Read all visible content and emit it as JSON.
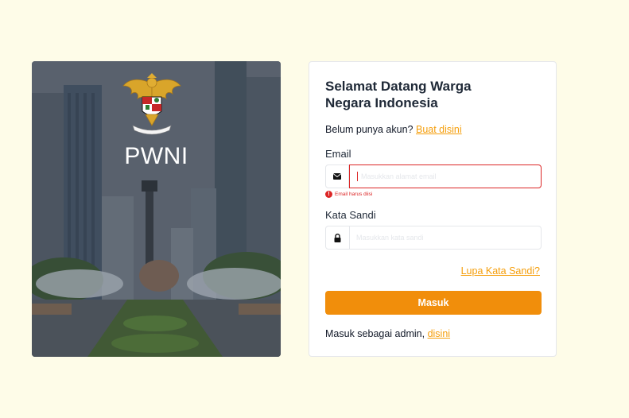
{
  "hero": {
    "brand": "PWNI",
    "emblem_icon": "garuda-emblem-icon"
  },
  "login": {
    "title": "Selamat Datang Warga Negara Indonesia",
    "signup_prompt": "Belum punya akun?",
    "signup_link": "Buat disini",
    "email_label": "Email",
    "email_placeholder": "Masukkan alamat email",
    "email_value": "",
    "email_error": "Email harus diisi",
    "password_label": "Kata Sandi",
    "password_placeholder": "Masukkan kata sandi",
    "password_value": "",
    "forgot_link": "Lupa Kata Sandi?",
    "submit_label": "Masuk",
    "admin_prompt": "Masuk sebagai admin,",
    "admin_link": "disini"
  },
  "colors": {
    "page_bg": "#fefce8",
    "accent": "#f18e0b",
    "link": "#f59e0b",
    "error": "#dc2626"
  },
  "icons": {
    "email": "envelope-icon",
    "password": "lock-icon",
    "error": "exclamation-circle-icon"
  }
}
